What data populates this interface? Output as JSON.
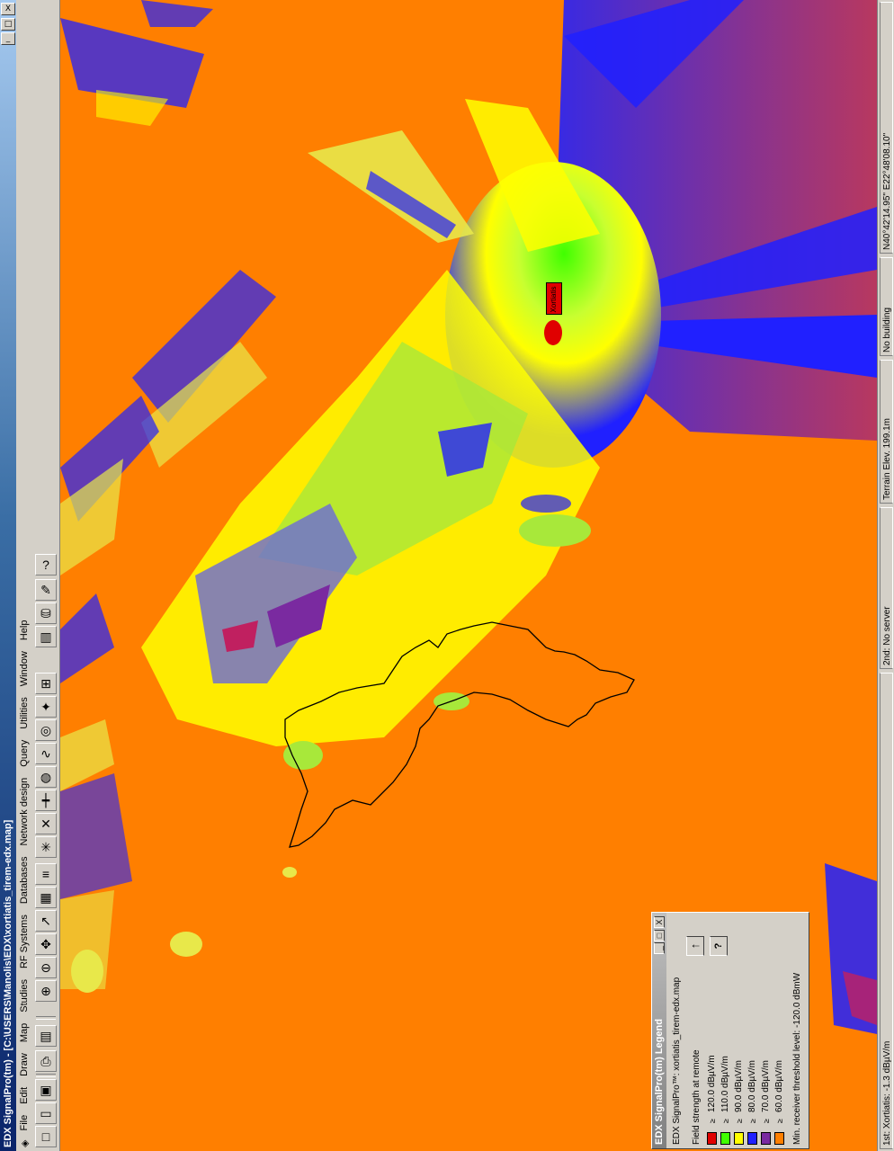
{
  "app": {
    "title": "EDX SignalPro(tm) - [C:\\USERS\\Manolis\\EDX\\xortiatis_tirem-edx.map]",
    "window_buttons": [
      "_",
      "□",
      "X"
    ]
  },
  "menu": {
    "items": [
      "File",
      "Edit",
      "Draw",
      "Map",
      "Studies",
      "RF Systems",
      "Databases",
      "Network design",
      "Query",
      "Utilities",
      "Window",
      "Help"
    ]
  },
  "toolbar": {
    "buttons": [
      "new-icon",
      "open-icon",
      "save-icon",
      "print-icon",
      "layers-icon",
      "zoom-in-icon",
      "zoom-out-icon",
      "pan-icon",
      "select-icon",
      "map-icon",
      "layers2-icon",
      "star-icon",
      "cross-icon",
      "ruler-icon",
      "globe-icon",
      "curve-icon",
      "target-icon",
      "network-icon",
      "new-service-icon",
      "chart-icon",
      "database-icon",
      "paint-icon",
      "help-icon"
    ]
  },
  "map": {
    "site_label": "Xortiatis",
    "colors": {
      "background": "#ff7f00",
      "red": "#e00000",
      "green": "#40ff00",
      "yellow": "#ffff00",
      "blue": "#2020ff",
      "purple": "#7a2aa0",
      "orange": "#ff7f00",
      "coastline": "#000000"
    }
  },
  "legend": {
    "title": "EDX SignalPro(tm) Legend",
    "file": "EDX SignalPro™: xortiatis_tirem-edx.map",
    "heading": "Field strength at remote",
    "arrow_button": "↑",
    "help_button": "?",
    "entries": [
      {
        "color": "#e00000",
        "label": "120.0 dBµV/m"
      },
      {
        "color": "#40ff00",
        "label": "110.0 dBµV/m"
      },
      {
        "color": "#ffff00",
        "label": "90.0 dBµV/m"
      },
      {
        "color": "#2020ff",
        "label": "80.0 dBµV/m"
      },
      {
        "color": "#7a2aa0",
        "label": "70.0 dBµV/m"
      },
      {
        "color": "#ff7f00",
        "label": "60.0 dBµV/m"
      }
    ],
    "footer": "Min. receiver threshold level: -120.0 dBmW"
  },
  "status": {
    "server1": "1st: Xortiatis: -1.3 dBµV/m",
    "server2": "2nd: No server",
    "terrain": "Terrain Elev. 199.1m",
    "building": "No building",
    "coords": "N40°42'14.95\" E22°48'08.10\""
  }
}
